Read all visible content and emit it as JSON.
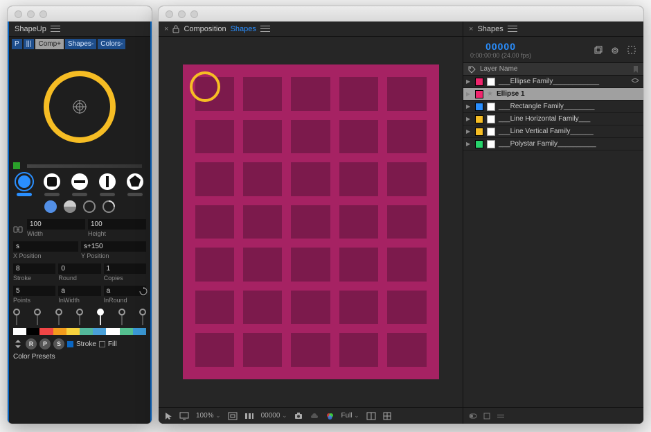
{
  "left": {
    "title": "ShapeUp",
    "topButtons": [
      {
        "label": "P",
        "bg": "#1e4e8c",
        "color": "#d8e8ff"
      },
      {
        "label": "|||",
        "bg": "#1e4e8c",
        "color": "#d8e8ff"
      },
      {
        "label": "Comp+",
        "bg": "#a0a0a0",
        "color": "#222"
      },
      {
        "label": "Shapes-",
        "bg": "#1e4e8c",
        "color": "#d8e8ff"
      },
      {
        "label": "Colors-",
        "bg": "#1e4e8c",
        "color": "#d8e8ff"
      }
    ],
    "fields": {
      "width": {
        "value": "100",
        "label": "Width"
      },
      "height": {
        "value": "100",
        "label": "Height"
      },
      "xpos": {
        "value": "s",
        "label": "X Position"
      },
      "ypos": {
        "value": "s+150",
        "label": "Y Position"
      },
      "stroke": {
        "value": "8",
        "label": "Stroke"
      },
      "round": {
        "value": "0",
        "label": "Round"
      },
      "copies": {
        "value": "1",
        "label": "Copies"
      },
      "points": {
        "value": "5",
        "label": "Points"
      },
      "inwidth": {
        "value": "a",
        "label": "InWidth"
      },
      "inround": {
        "value": "a",
        "label": "InRound"
      }
    },
    "swatches": [
      "#ffffff",
      "#000000",
      "#f04646",
      "#f29b1d",
      "#f7d23e",
      "#54b89b",
      "#4aa0d8",
      "#ffffff",
      "#55c090",
      "#3a97d4"
    ],
    "bottom": {
      "stroke": "Stroke",
      "fill": "Fill",
      "presets": "Color Presets",
      "letters": [
        "R",
        "P",
        "S"
      ]
    }
  },
  "comp": {
    "title_a": "Composition",
    "title_b": "Shapes",
    "zoom": "100%",
    "tc": "00000",
    "res": "Full"
  },
  "shapes": {
    "title": "Shapes",
    "tc_big": "00000",
    "tc_small": "0:00:00:00 (24.00 fps)",
    "col": "Layer Name",
    "layers": [
      {
        "color": "#f0256d",
        "name": "___Ellipse Family____________",
        "sel": false,
        "star": false
      },
      {
        "color": "#f0256d",
        "name": "Ellipse 1",
        "sel": true,
        "star": true
      },
      {
        "color": "#2a8fff",
        "name": "___Rectangle Family________",
        "sel": false,
        "star": false
      },
      {
        "color": "#f6bd24",
        "name": "___Line Horizontal Family___",
        "sel": false,
        "star": false
      },
      {
        "color": "#f6bd24",
        "name": "___Line Vertical Family______",
        "sel": false,
        "star": false
      },
      {
        "color": "#27d36b",
        "name": "___Polystar Family__________",
        "sel": false,
        "star": false
      }
    ]
  }
}
